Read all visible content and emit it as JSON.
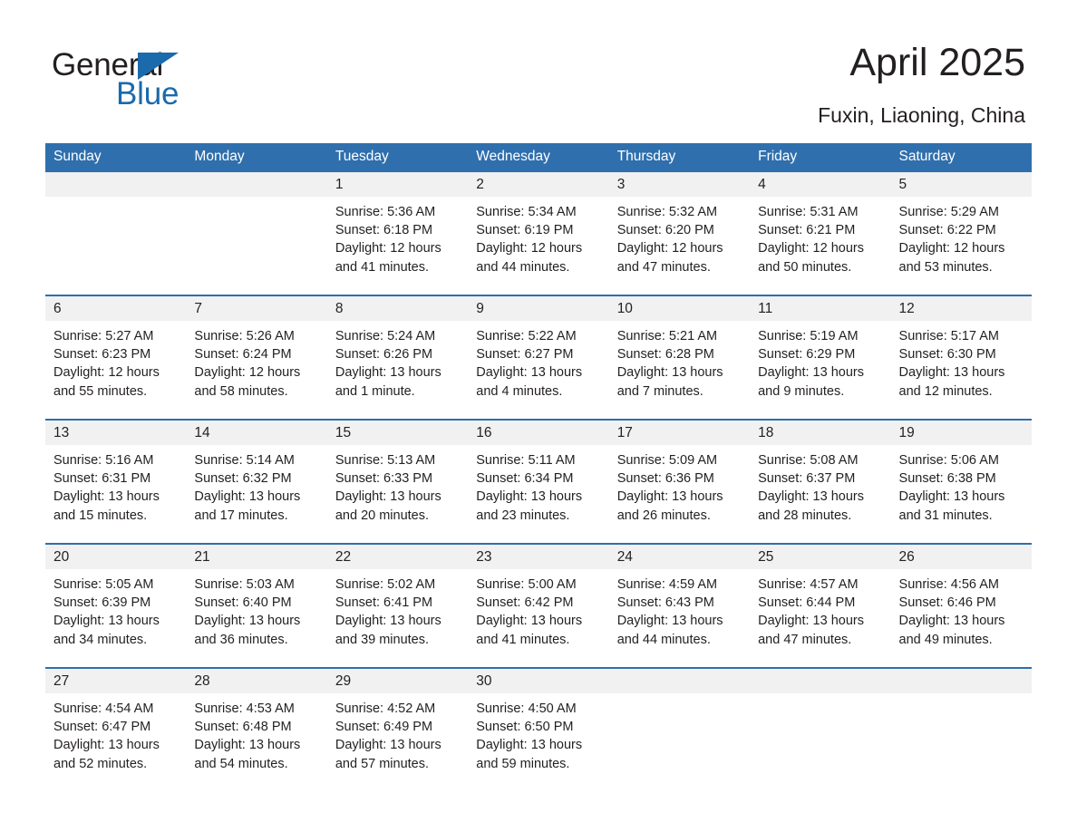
{
  "brand": {
    "name_part1": "General",
    "name_part2": "Blue",
    "accent_color": "#1b6aab"
  },
  "header": {
    "title": "April 2025",
    "subtitle": "Fuxin, Liaoning, China"
  },
  "colors": {
    "header_band": "#2f6fad",
    "daynum_band": "#f1f1f1",
    "text": "#231f20"
  },
  "weekdays": [
    "Sunday",
    "Monday",
    "Tuesday",
    "Wednesday",
    "Thursday",
    "Friday",
    "Saturday"
  ],
  "weeks": [
    {
      "days": [
        {
          "num": "",
          "sunrise": "",
          "sunset": "",
          "daylight1": "",
          "daylight2": ""
        },
        {
          "num": "",
          "sunrise": "",
          "sunset": "",
          "daylight1": "",
          "daylight2": ""
        },
        {
          "num": "1",
          "sunrise": "Sunrise: 5:36 AM",
          "sunset": "Sunset: 6:18 PM",
          "daylight1": "Daylight: 12 hours",
          "daylight2": "and 41 minutes."
        },
        {
          "num": "2",
          "sunrise": "Sunrise: 5:34 AM",
          "sunset": "Sunset: 6:19 PM",
          "daylight1": "Daylight: 12 hours",
          "daylight2": "and 44 minutes."
        },
        {
          "num": "3",
          "sunrise": "Sunrise: 5:32 AM",
          "sunset": "Sunset: 6:20 PM",
          "daylight1": "Daylight: 12 hours",
          "daylight2": "and 47 minutes."
        },
        {
          "num": "4",
          "sunrise": "Sunrise: 5:31 AM",
          "sunset": "Sunset: 6:21 PM",
          "daylight1": "Daylight: 12 hours",
          "daylight2": "and 50 minutes."
        },
        {
          "num": "5",
          "sunrise": "Sunrise: 5:29 AM",
          "sunset": "Sunset: 6:22 PM",
          "daylight1": "Daylight: 12 hours",
          "daylight2": "and 53 minutes."
        }
      ]
    },
    {
      "days": [
        {
          "num": "6",
          "sunrise": "Sunrise: 5:27 AM",
          "sunset": "Sunset: 6:23 PM",
          "daylight1": "Daylight: 12 hours",
          "daylight2": "and 55 minutes."
        },
        {
          "num": "7",
          "sunrise": "Sunrise: 5:26 AM",
          "sunset": "Sunset: 6:24 PM",
          "daylight1": "Daylight: 12 hours",
          "daylight2": "and 58 minutes."
        },
        {
          "num": "8",
          "sunrise": "Sunrise: 5:24 AM",
          "sunset": "Sunset: 6:26 PM",
          "daylight1": "Daylight: 13 hours",
          "daylight2": "and 1 minute."
        },
        {
          "num": "9",
          "sunrise": "Sunrise: 5:22 AM",
          "sunset": "Sunset: 6:27 PM",
          "daylight1": "Daylight: 13 hours",
          "daylight2": "and 4 minutes."
        },
        {
          "num": "10",
          "sunrise": "Sunrise: 5:21 AM",
          "sunset": "Sunset: 6:28 PM",
          "daylight1": "Daylight: 13 hours",
          "daylight2": "and 7 minutes."
        },
        {
          "num": "11",
          "sunrise": "Sunrise: 5:19 AM",
          "sunset": "Sunset: 6:29 PM",
          "daylight1": "Daylight: 13 hours",
          "daylight2": "and 9 minutes."
        },
        {
          "num": "12",
          "sunrise": "Sunrise: 5:17 AM",
          "sunset": "Sunset: 6:30 PM",
          "daylight1": "Daylight: 13 hours",
          "daylight2": "and 12 minutes."
        }
      ]
    },
    {
      "days": [
        {
          "num": "13",
          "sunrise": "Sunrise: 5:16 AM",
          "sunset": "Sunset: 6:31 PM",
          "daylight1": "Daylight: 13 hours",
          "daylight2": "and 15 minutes."
        },
        {
          "num": "14",
          "sunrise": "Sunrise: 5:14 AM",
          "sunset": "Sunset: 6:32 PM",
          "daylight1": "Daylight: 13 hours",
          "daylight2": "and 17 minutes."
        },
        {
          "num": "15",
          "sunrise": "Sunrise: 5:13 AM",
          "sunset": "Sunset: 6:33 PM",
          "daylight1": "Daylight: 13 hours",
          "daylight2": "and 20 minutes."
        },
        {
          "num": "16",
          "sunrise": "Sunrise: 5:11 AM",
          "sunset": "Sunset: 6:34 PM",
          "daylight1": "Daylight: 13 hours",
          "daylight2": "and 23 minutes."
        },
        {
          "num": "17",
          "sunrise": "Sunrise: 5:09 AM",
          "sunset": "Sunset: 6:36 PM",
          "daylight1": "Daylight: 13 hours",
          "daylight2": "and 26 minutes."
        },
        {
          "num": "18",
          "sunrise": "Sunrise: 5:08 AM",
          "sunset": "Sunset: 6:37 PM",
          "daylight1": "Daylight: 13 hours",
          "daylight2": "and 28 minutes."
        },
        {
          "num": "19",
          "sunrise": "Sunrise: 5:06 AM",
          "sunset": "Sunset: 6:38 PM",
          "daylight1": "Daylight: 13 hours",
          "daylight2": "and 31 minutes."
        }
      ]
    },
    {
      "days": [
        {
          "num": "20",
          "sunrise": "Sunrise: 5:05 AM",
          "sunset": "Sunset: 6:39 PM",
          "daylight1": "Daylight: 13 hours",
          "daylight2": "and 34 minutes."
        },
        {
          "num": "21",
          "sunrise": "Sunrise: 5:03 AM",
          "sunset": "Sunset: 6:40 PM",
          "daylight1": "Daylight: 13 hours",
          "daylight2": "and 36 minutes."
        },
        {
          "num": "22",
          "sunrise": "Sunrise: 5:02 AM",
          "sunset": "Sunset: 6:41 PM",
          "daylight1": "Daylight: 13 hours",
          "daylight2": "and 39 minutes."
        },
        {
          "num": "23",
          "sunrise": "Sunrise: 5:00 AM",
          "sunset": "Sunset: 6:42 PM",
          "daylight1": "Daylight: 13 hours",
          "daylight2": "and 41 minutes."
        },
        {
          "num": "24",
          "sunrise": "Sunrise: 4:59 AM",
          "sunset": "Sunset: 6:43 PM",
          "daylight1": "Daylight: 13 hours",
          "daylight2": "and 44 minutes."
        },
        {
          "num": "25",
          "sunrise": "Sunrise: 4:57 AM",
          "sunset": "Sunset: 6:44 PM",
          "daylight1": "Daylight: 13 hours",
          "daylight2": "and 47 minutes."
        },
        {
          "num": "26",
          "sunrise": "Sunrise: 4:56 AM",
          "sunset": "Sunset: 6:46 PM",
          "daylight1": "Daylight: 13 hours",
          "daylight2": "and 49 minutes."
        }
      ]
    },
    {
      "days": [
        {
          "num": "27",
          "sunrise": "Sunrise: 4:54 AM",
          "sunset": "Sunset: 6:47 PM",
          "daylight1": "Daylight: 13 hours",
          "daylight2": "and 52 minutes."
        },
        {
          "num": "28",
          "sunrise": "Sunrise: 4:53 AM",
          "sunset": "Sunset: 6:48 PM",
          "daylight1": "Daylight: 13 hours",
          "daylight2": "and 54 minutes."
        },
        {
          "num": "29",
          "sunrise": "Sunrise: 4:52 AM",
          "sunset": "Sunset: 6:49 PM",
          "daylight1": "Daylight: 13 hours",
          "daylight2": "and 57 minutes."
        },
        {
          "num": "30",
          "sunrise": "Sunrise: 4:50 AM",
          "sunset": "Sunset: 6:50 PM",
          "daylight1": "Daylight: 13 hours",
          "daylight2": "and 59 minutes."
        },
        {
          "num": "",
          "sunrise": "",
          "sunset": "",
          "daylight1": "",
          "daylight2": ""
        },
        {
          "num": "",
          "sunrise": "",
          "sunset": "",
          "daylight1": "",
          "daylight2": ""
        },
        {
          "num": "",
          "sunrise": "",
          "sunset": "",
          "daylight1": "",
          "daylight2": ""
        }
      ]
    }
  ]
}
